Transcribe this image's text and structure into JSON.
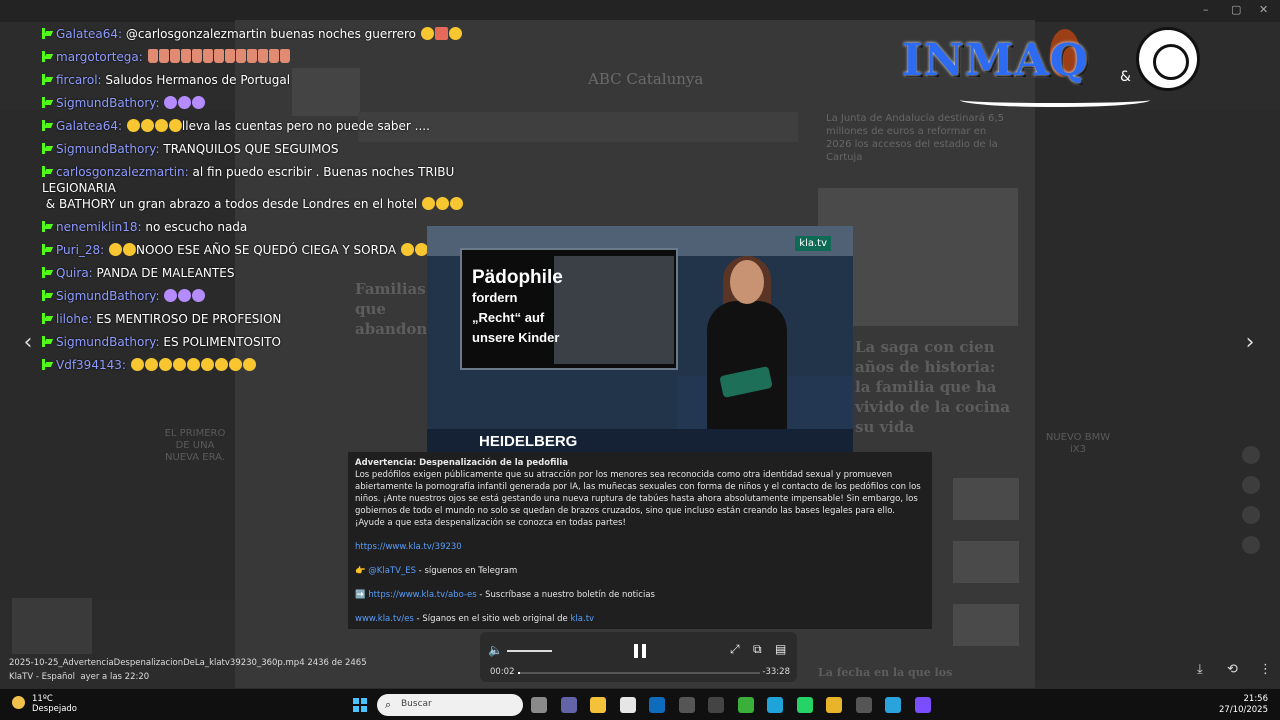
{
  "browser": {
    "window_controls": [
      "–",
      "▢",
      "✕"
    ]
  },
  "background_page": {
    "site_name": "ABC Catalunya",
    "headline_1": "Familias que abandonaron",
    "headline_2": "La saga con cien años de historia: la familia que ha vivido de la cocina su vida",
    "side_news": "La Junta de Andalucía destinará 6,5 millones de euros a reformar en 2026 los accesos del estadio de la Cartuja",
    "ad_left": "EL PRIMERO DE UNA NUEVA ERA.",
    "ad_right": "NUEVO BMW iX3",
    "bottom_item": "La fecha en la que los"
  },
  "chat": {
    "messages": [
      {
        "user": "Galatea64:",
        "text": "@carlosgonzalezmartin buenas noches guerrero",
        "emoji": [
          "face",
          "red",
          "face"
        ]
      },
      {
        "user": "margotortega:",
        "text": "",
        "hands": 13
      },
      {
        "user": "fircarol:",
        "text": "Saludos Hermanos de Portugal"
      },
      {
        "user": "SigmundBathory:",
        "text": "",
        "emoji": [
          "purple",
          "purple",
          "purple"
        ]
      },
      {
        "user": "Galatea64:",
        "text": "lleva las cuentas pero no puede saber ....",
        "emoji_before": [
          "face",
          "face",
          "face",
          "face"
        ]
      },
      {
        "user": "SigmundBathory:",
        "text": "TRANQUILOS QUE SEGUIMOS"
      },
      {
        "user": "carlosgonzalezmartin:",
        "text": "al fin puedo escribir . Buenas noches TRIBU LEGIONARIA",
        "text2": "y INMA & BATHORY un gran abrazo a todos desde Londres en el hotel",
        "emoji": [
          "face",
          "face",
          "face"
        ]
      },
      {
        "user": "nenemiklin18:",
        "text": "no escucho nada"
      },
      {
        "user": "Puri_28:",
        "text": "NOOO ESE AÑO SE QUEDÓ CIEGA Y SORDA",
        "emoji_before": [
          "face",
          "face"
        ],
        "emoji": [
          "face",
          "face",
          "face"
        ]
      },
      {
        "user": "Quira:",
        "text": "PANDA DE MALEANTES"
      },
      {
        "user": "SigmundBathory:",
        "text": "",
        "emoji": [
          "purple",
          "purple",
          "purple"
        ]
      },
      {
        "user": "lilohe:",
        "text": "ES MENTIROSO DE PROFESION"
      },
      {
        "user": "SigmundBathory:",
        "text": "ES POLIMENTOSITO"
      },
      {
        "user": "Vdf394143:",
        "text": "",
        "emoji": [
          "face",
          "face",
          "face",
          "face",
          "face",
          "face",
          "face",
          "face",
          "face"
        ]
      }
    ]
  },
  "logo": {
    "text": "INMAQ",
    "amp": "&"
  },
  "video": {
    "screen_line1": "Pädophile",
    "screen_line2": "fordern",
    "screen_line3": "„Recht“ auf",
    "screen_line4": "unsere Kinder",
    "channel_badge": "kla.tv",
    "location": "HEIDELBERG"
  },
  "description": {
    "title": "Advertencia: Despenalización de la pedofilia",
    "body": "Los pedófilos exigen públicamente que su atracción por los menores sea reconocida como otra identidad sexual y promueven abiertamente la pornografía infantil generada por IA, las muñecas sexuales con forma de niños y el contacto de los pedófilos con los niños. ¡Ante nuestros ojos se está gestando una nueva ruptura de tabúes hasta ahora absolutamente impensable! Sin embargo, los gobiernos de todo el mundo no solo se quedan de brazos cruzados, sino que incluso están creando las bases legales para ello. ¡Ayude a que esta despenalización se conozca en todas partes!",
    "link1": "https://www.kla.tv/39230",
    "telegram_icon": "👉",
    "telegram_link": "@KlaTV_ES",
    "telegram_text": " - síguenos en Telegram",
    "newsletter_icon": "➡️",
    "newsletter_link": "https://www.kla.tv/abo-es",
    "newsletter_text": " - Suscríbase a nuestro boletín de noticias",
    "site_link": "www.kla.tv/es",
    "site_text": " - Síganos en el sitio web original de ",
    "site_link2": "kla.tv"
  },
  "player": {
    "time_elapsed": "00:02",
    "time_remaining": "-33:28",
    "progress": 0.008,
    "volume_icon": "speaker-icon",
    "fullscreen_icon": "expand-icon",
    "pip_icon": "pip-icon",
    "subtitles_icon": "subtitles-icon"
  },
  "file": {
    "name": "2025-10-25_AdvertenciaDespenalizacionDeLa_klatv39230_360p.mp4 2436 de 2465",
    "channel": "KlaTV - Español",
    "date": "ayer a las 22:20"
  },
  "taskbar": {
    "temperature": "11ºC",
    "condition": "Despejado",
    "search_placeholder": "Buscar",
    "time": "21:56",
    "date": "27/10/2025",
    "apps": [
      {
        "name": "task-view",
        "color": "#8a8a8a"
      },
      {
        "name": "teams",
        "color": "#6264a7"
      },
      {
        "name": "file-explorer",
        "color": "#f3c13a"
      },
      {
        "name": "store",
        "color": "#e6e6e6"
      },
      {
        "name": "outlook",
        "color": "#0f6cbd"
      },
      {
        "name": "app-6",
        "color": "#555555"
      },
      {
        "name": "app-7",
        "color": "#444444"
      },
      {
        "name": "app-8",
        "color": "#3aaf3a"
      },
      {
        "name": "edge",
        "color": "#1fa3d8"
      },
      {
        "name": "whatsapp",
        "color": "#25d366"
      },
      {
        "name": "chrome",
        "color": "#e8b52a"
      },
      {
        "name": "app-12",
        "color": "#555555"
      },
      {
        "name": "telegram",
        "color": "#2aa3dc"
      },
      {
        "name": "app-14",
        "color": "#7a4dff"
      }
    ]
  }
}
